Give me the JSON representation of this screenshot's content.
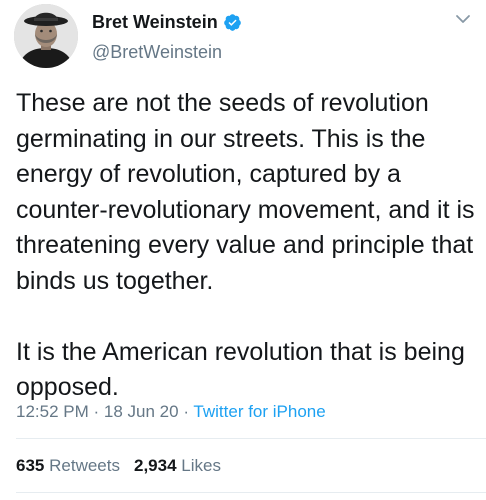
{
  "author": {
    "display_name": "Bret Weinstein",
    "handle": "@BretWeinstein",
    "verified": true,
    "avatar_icon": "profile-photo-man-with-hat"
  },
  "tweet": {
    "paragraphs": [
      "These are not the seeds of revolution germinating in our streets. This is the energy of revolution, captured by a counter-revolutionary movement, and it is threatening every value and principle that binds us together.",
      "It is the American revolution that is being opposed."
    ]
  },
  "meta": {
    "time": "12:52 PM",
    "separator": "·",
    "date": "18 Jun 20",
    "source": "Twitter for iPhone"
  },
  "stats": {
    "retweets_count": "635",
    "retweets_label": "Retweets",
    "likes_count": "2,934",
    "likes_label": "Likes"
  },
  "colors": {
    "text": "#14171a",
    "secondary": "#657786",
    "accent": "#1da1f2",
    "divider": "#e6ecf0"
  },
  "icons": {
    "verified": "verified-badge-icon",
    "menu": "chevron-down-icon"
  }
}
